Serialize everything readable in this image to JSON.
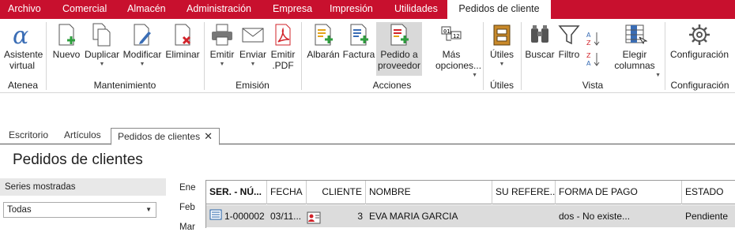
{
  "menu": [
    "Archivo",
    "Comercial",
    "Almacén",
    "Administración",
    "Empresa",
    "Impresión",
    "Utilidades",
    "Pedidos de cliente"
  ],
  "ribbon": {
    "asistente": "Asistente virtual",
    "nuevo": "Nuevo",
    "duplicar": "Duplicar",
    "modificar": "Modificar",
    "eliminar": "Eliminar",
    "emitir": "Emitir",
    "enviar": "Enviar",
    "emitir_pdf": "Emitir .PDF",
    "albaran": "Albarán",
    "factura": "Factura",
    "pedido_proveedor": "Pedido a proveedor",
    "mas_opciones": "Más opciones...",
    "utiles": "Útiles",
    "buscar": "Buscar",
    "filtro": "Filtro",
    "elegir_columnas": "Elegir columnas",
    "configuracion": "Configuración",
    "groups": {
      "atenea": "Atenea",
      "mantenimiento": "Mantenimiento",
      "emision": "Emisión",
      "acciones": "Acciones",
      "utiles": "Útiles",
      "vista": "Vista",
      "configuracion": "Configuración"
    }
  },
  "tabs": [
    "Escritorio",
    "Artículos",
    "Pedidos de clientes"
  ],
  "page_title": "Pedidos de clientes",
  "series": {
    "header": "Series mostradas",
    "selected": "Todas"
  },
  "months": [
    "Ene",
    "Feb",
    "Mar"
  ],
  "table": {
    "columns": [
      "SER. - NÚ...",
      "FECHA",
      "CLIENTE",
      "NOMBRE",
      "SU REFERE...",
      "FORMA DE PAGO",
      "ESTADO"
    ],
    "rows": [
      {
        "numero": "1-000002",
        "fecha": "03/11...",
        "cliente": "3",
        "nombre": "EVA MARIA GARCIA",
        "referencia": "",
        "forma_pago": "dos - No existe...",
        "estado": "Pendiente"
      }
    ]
  },
  "colors": {
    "menubar": "#c8102e",
    "accent_green": "#2e9e3e",
    "accent_red": "#d2232a",
    "accent_blue": "#1f5fa8"
  }
}
